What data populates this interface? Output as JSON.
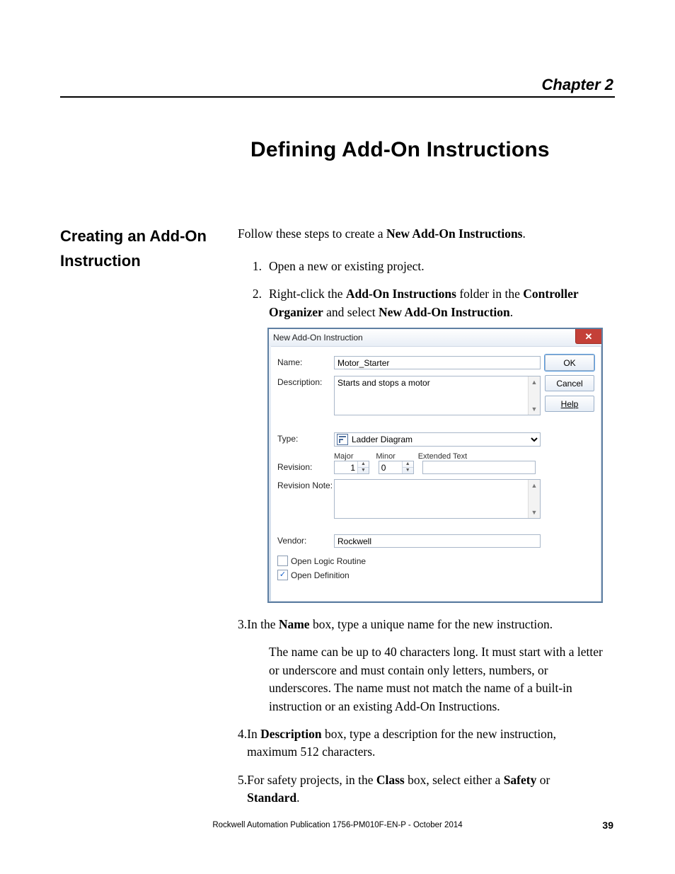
{
  "header": {
    "chapter": "Chapter 2"
  },
  "title": "Defining Add-On Instructions",
  "sideHeading": "Creating an Add-On Instruction",
  "intro": {
    "pre": "Follow these steps to create a ",
    "bold": "New Add-On Instructions",
    "post": "."
  },
  "steps": {
    "s1": {
      "num": "1.",
      "text": "Open a new or existing project."
    },
    "s2": {
      "num": "2.",
      "t1": "Right-click the ",
      "b1": "Add-On Instructions",
      "t2": " folder in the ",
      "b2": "Controller Organizer",
      "t3": " and select ",
      "b3": "New Add-On Instruction",
      "t4": "."
    },
    "s3": {
      "num": "3.",
      "t1": "In the ",
      "b1": "Name",
      "t2": " box, type a unique name for the new instruction."
    },
    "s3p": "The name can be up to 40 characters long. It must start with a letter or underscore and must contain only letters, numbers, or underscores. The name must not match the name of a built-in instruction or an existing Add-On Instructions.",
    "s4": {
      "num": "4.",
      "t1": "In ",
      "b1": "Description",
      "t2": " box, type a description for the new instruction, maximum 512 characters."
    },
    "s5": {
      "num": "5.",
      "t1": "For safety projects, in the ",
      "b1": "Class",
      "t2": " box, select either a ",
      "b2": "Safety",
      "t3": " or ",
      "b3": "Standard",
      "t4": "."
    }
  },
  "dialog": {
    "title": "New Add-On Instruction",
    "close": "✕",
    "labels": {
      "name": "Name:",
      "description": "Description:",
      "type": "Type:",
      "revision": "Revision:",
      "revnote": "Revision Note:",
      "vendor": "Vendor:",
      "major": "Major",
      "minor": "Minor",
      "ext": "Extended Text"
    },
    "values": {
      "name": "Motor_Starter",
      "description": "Starts and stops a motor",
      "type": "Ladder Diagram",
      "major": "1",
      "minor": "0",
      "ext": "",
      "revnote": "",
      "vendor": "Rockwell"
    },
    "checks": {
      "openLogic": {
        "label": "Open Logic Routine",
        "checked": false
      },
      "openDef": {
        "label": "Open Definition",
        "checked": true
      }
    },
    "buttons": {
      "ok": "OK",
      "cancel": "Cancel",
      "help": "Help"
    }
  },
  "footer": {
    "pub": "Rockwell Automation Publication 1756-PM010F-EN-P - October 2014",
    "page": "39"
  }
}
